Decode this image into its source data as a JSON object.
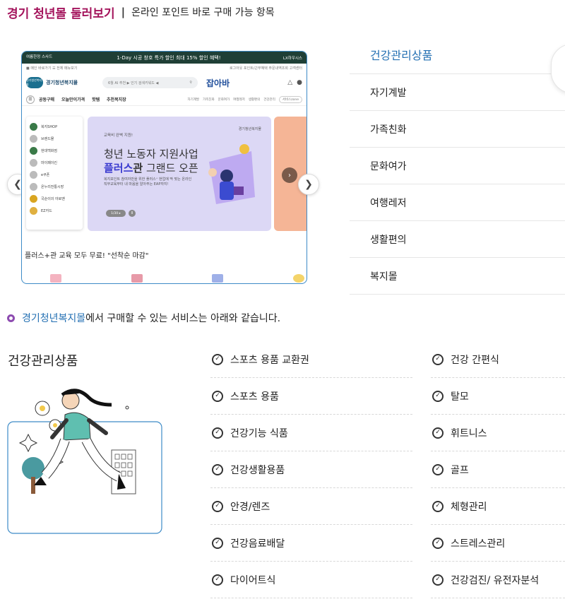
{
  "header": {
    "title": "경기 청년몰 둘러보기",
    "separator": "|",
    "subtitle": "온라인 포인트 바로 구매 가능 항목"
  },
  "carousel": {
    "prev_icon": "chevron-left-icon",
    "next_icon": "chevron-right-icon",
    "screenshot": {
      "topbar_left": "여름한정 스사드",
      "topbar_center": "1-Day 시공 창호 특가 할인  최대 15% 할인 혜택!",
      "topbar_right": "LX하우시스",
      "util_left": "■ 메인 바로가기  ☰ 전체 메뉴보기",
      "util_right": "로그아웃  포인트/근무혜택  주문내역조회  고객센터",
      "logo_badge": "경기청년복지몰",
      "logo_text": "경기청년복지몰",
      "search_placeholder": "6월 AI 추천 ▶ 인기 검색키워드 ◀",
      "brand": "잡아바",
      "nav_main": [
        "공동구매",
        "오늘만이가격",
        "핫템",
        "추천복지장"
      ],
      "nav_sub": [
        "자기계발",
        "가족친화",
        "문화여가",
        "여행레저",
        "생활편의",
        "건강관리"
      ],
      "nav_pill": "서비스zone",
      "side_menu": [
        "복지SHOP",
        "브랜드몰",
        "현대백화점",
        "마이페이킨",
        "e쿠폰",
        "온누리전통시장",
        "국순이의 야로맨",
        "EZ카드"
      ],
      "banner_small": "교육비 완벽 지원!",
      "banner_line1": "청년 노동자 지원사업",
      "banner_hl": "플러스",
      "banner_hl2": "관",
      "banner_line2_rest": " 그랜드 오픈",
      "banner_desc": "복지포인트 참여자만을 위한 플러스⁺ 현업에 딱 맞는 온라인 직무교육부터 내 마음을 알아주는 EAP까지!",
      "banner_pager": "1/30 ▸",
      "banner_pause": "II",
      "banner_logo": "경기청년복지몰",
      "promo_text": "플러스+관 교육 모두 무료! \"선착순 마감\""
    }
  },
  "categories": [
    "건강관리상품",
    "자기계발",
    "가족친화",
    "문화여가",
    "여행레저",
    "생활편의",
    "복지몰"
  ],
  "info": {
    "mall_name": "경기청년복지몰",
    "text": "에서 구매할 수 있는 서비스는 아래와 같습니다."
  },
  "section": {
    "title": "건강관리상품",
    "col1": [
      "스포츠 용품 교환권",
      "스포츠 용품",
      "건강기능 식품",
      "건강생활용품",
      "안경/렌즈",
      "건강음료배달",
      "다이어트식"
    ],
    "col2": [
      "건강 간편식",
      "탈모",
      "휘트니스",
      "골프",
      "체형관리",
      "스트레스관리",
      "건강검진/ 유전자분석"
    ]
  },
  "colors": {
    "title": "#a4145c",
    "accent_blue": "#2470b3",
    "ring": "#8d4bb0",
    "frame_border": "#3d8bc7"
  }
}
